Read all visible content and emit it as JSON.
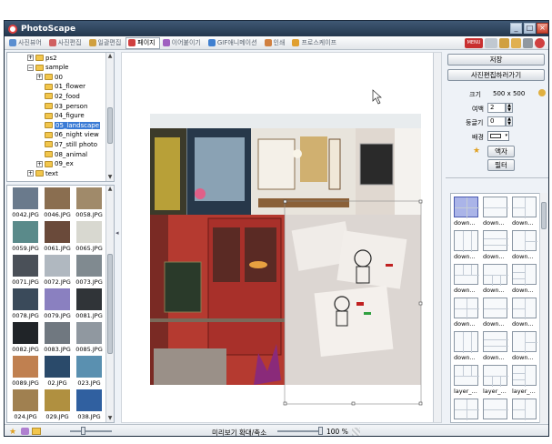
{
  "window": {
    "title": "PhotoScape"
  },
  "tabs": [
    {
      "label": "사진뷰어",
      "icon": "photo-viewer-icon",
      "color": "#5b8fd0"
    },
    {
      "label": "사진편집",
      "icon": "photo-editor-icon",
      "color": "#d06060"
    },
    {
      "label": "일괄편집",
      "icon": "batch-editor-icon",
      "color": "#d0a040"
    },
    {
      "label": "페이지",
      "icon": "page-icon",
      "color": "#d04040",
      "active": true
    },
    {
      "label": "이어붙이기",
      "icon": "combine-icon",
      "color": "#a060c0"
    },
    {
      "label": "GIF애니메이션",
      "icon": "gif-animation-icon",
      "color": "#4080d0"
    },
    {
      "label": "인쇄",
      "icon": "print-icon",
      "color": "#d08040"
    },
    {
      "label": "프로스케이프",
      "icon": "photoscape-icon",
      "color": "#e0a030"
    }
  ],
  "toolbar_right": {
    "menu_label": "MENU"
  },
  "folder_tree": [
    {
      "label": "ps2",
      "level": 1,
      "toggle": "+"
    },
    {
      "label": "sample",
      "level": 1,
      "toggle": "-"
    },
    {
      "label": "00",
      "level": 2,
      "toggle": "+"
    },
    {
      "label": "01_flower",
      "level": 2
    },
    {
      "label": "02_food",
      "level": 2
    },
    {
      "label": "03_person",
      "level": 2
    },
    {
      "label": "04_figure",
      "level": 2
    },
    {
      "label": "05_landscape",
      "level": 2,
      "selected": true
    },
    {
      "label": "06_night view",
      "level": 2
    },
    {
      "label": "07_still photo",
      "level": 2
    },
    {
      "label": "08_animal",
      "level": 2
    },
    {
      "label": "09_ex",
      "level": 2,
      "toggle": "+"
    },
    {
      "label": "text",
      "level": 1,
      "toggle": "+"
    }
  ],
  "thumbnails": [
    {
      "name": "0042.JPG",
      "color": "#6a7a8c"
    },
    {
      "name": "0046.JPG",
      "color": "#8a6e50"
    },
    {
      "name": "0058.JPG",
      "color": "#a08a6a"
    },
    {
      "name": "0059.JPG",
      "color": "#5a8a8a"
    },
    {
      "name": "0061.JPG",
      "color": "#6a4a3a"
    },
    {
      "name": "0065.JPG",
      "color": "#d8d8d0"
    },
    {
      "name": "0071.JPG",
      "color": "#4a5058"
    },
    {
      "name": "0072.JPG",
      "color": "#b0b8c0"
    },
    {
      "name": "0073.JPG",
      "color": "#808a90"
    },
    {
      "name": "0078.JPG",
      "color": "#3a4a5a"
    },
    {
      "name": "0079.JPG",
      "color": "#8a80c0"
    },
    {
      "name": "0081.JPG",
      "color": "#303438"
    },
    {
      "name": "0082.JPG",
      "color": "#202428"
    },
    {
      "name": "0083.JPG",
      "color": "#707880"
    },
    {
      "name": "0085.JPG",
      "color": "#9098a0"
    },
    {
      "name": "0089.JPG",
      "color": "#c08050"
    },
    {
      "name": "02.JPG",
      "color": "#2a4a6a"
    },
    {
      "name": "023.JPG",
      "color": "#5a90b0"
    },
    {
      "name": "024.JPG",
      "color": "#a08050"
    },
    {
      "name": "029.JPG",
      "color": "#b09040"
    },
    {
      "name": "038.JPG",
      "color": "#3060a0"
    }
  ],
  "bottom": {
    "preview_label": "미리보기 확대/축소",
    "zoom": "100 %",
    "zoom_value": 1.0
  },
  "right_panel": {
    "save_label": "저장",
    "edit_label": "사진편집하러가기",
    "size_label": "크기",
    "size_value": "500 x 500",
    "margin_label": "여백",
    "margin_value": "2",
    "round_label": "둥글기",
    "round_value": "0",
    "bg_label": "배경",
    "bg_color": "#ffffff",
    "frame_label": "액자",
    "filter_label": "필터"
  },
  "layouts": [
    {
      "caption": "down...",
      "selected": true
    },
    {
      "caption": "down..."
    },
    {
      "caption": "down..."
    },
    {
      "caption": "down..."
    },
    {
      "caption": "down..."
    },
    {
      "caption": "down..."
    },
    {
      "caption": "down..."
    },
    {
      "caption": "down..."
    },
    {
      "caption": "down..."
    },
    {
      "caption": "down..."
    },
    {
      "caption": "down..."
    },
    {
      "caption": "down..."
    },
    {
      "caption": "down..."
    },
    {
      "caption": "down..."
    },
    {
      "caption": "down..."
    },
    {
      "caption": "layer_..."
    },
    {
      "caption": "layer_..."
    },
    {
      "caption": "layer_..."
    },
    {
      "caption": ""
    },
    {
      "caption": ""
    },
    {
      "caption": ""
    }
  ],
  "colors": {
    "titlebar": "#2c4058",
    "accent": "#3a7bd5",
    "storefront_red": "#c0392b"
  }
}
